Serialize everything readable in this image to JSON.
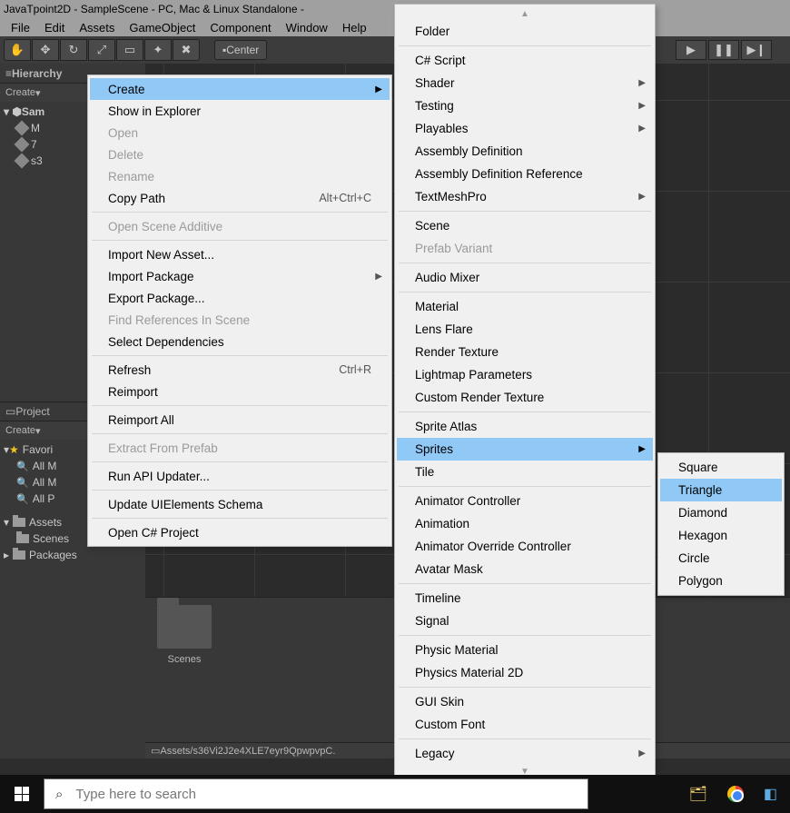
{
  "titlebar": "JavaTpoint2D - SampleScene - PC, Mac & Linux Standalone -",
  "menubar": [
    "File",
    "Edit",
    "Assets",
    "GameObject",
    "Component",
    "Window",
    "Help"
  ],
  "toolbar": {
    "center_button": "Center",
    "tool_icons": [
      "hand",
      "move",
      "rotate",
      "scale",
      "rect",
      "transform",
      "custom"
    ]
  },
  "hierarchy": {
    "title": "Hierarchy",
    "create_label": "Create",
    "scene_name": "Sam",
    "items": [
      "M",
      "7",
      "s3"
    ]
  },
  "project": {
    "title": "Project",
    "create_label": "Create",
    "favorites_label": "Favori",
    "fav_items": [
      "All M",
      "All M",
      "All P"
    ],
    "assets_label": "Assets",
    "assets_children": [
      "Scenes"
    ],
    "packages_label": "Packages"
  },
  "asset_grid": {
    "item_label": "Scenes"
  },
  "path_bar": "Assets/s36Vi2J2e4XLE7eyr9QpwpvpC.",
  "context_menu_1": {
    "items": [
      {
        "label": "Create",
        "submenu": true,
        "highlight": true
      },
      {
        "label": "Show in Explorer"
      },
      {
        "label": "Open",
        "disabled": true
      },
      {
        "label": "Delete",
        "disabled": true
      },
      {
        "label": "Rename",
        "disabled": true
      },
      {
        "label": "Copy Path",
        "shortcut": "Alt+Ctrl+C"
      },
      {
        "sep": true
      },
      {
        "label": "Open Scene Additive",
        "disabled": true
      },
      {
        "sep": true
      },
      {
        "label": "Import New Asset..."
      },
      {
        "label": "Import Package",
        "submenu": true
      },
      {
        "label": "Export Package..."
      },
      {
        "label": "Find References In Scene",
        "disabled": true
      },
      {
        "label": "Select Dependencies"
      },
      {
        "sep": true
      },
      {
        "label": "Refresh",
        "shortcut": "Ctrl+R"
      },
      {
        "label": "Reimport"
      },
      {
        "sep": true
      },
      {
        "label": "Reimport All"
      },
      {
        "sep": true
      },
      {
        "label": "Extract From Prefab",
        "disabled": true
      },
      {
        "sep": true
      },
      {
        "label": "Run API Updater..."
      },
      {
        "sep": true
      },
      {
        "label": "Update UIElements Schema"
      },
      {
        "sep": true
      },
      {
        "label": "Open C# Project"
      }
    ]
  },
  "context_menu_2": {
    "items": [
      {
        "label": "Folder"
      },
      {
        "sep": true
      },
      {
        "label": "C# Script"
      },
      {
        "label": "Shader",
        "submenu": true
      },
      {
        "label": "Testing",
        "submenu": true
      },
      {
        "label": "Playables",
        "submenu": true
      },
      {
        "label": "Assembly Definition"
      },
      {
        "label": "Assembly Definition Reference"
      },
      {
        "label": "TextMeshPro",
        "submenu": true
      },
      {
        "sep": true
      },
      {
        "label": "Scene"
      },
      {
        "label": "Prefab Variant",
        "disabled": true
      },
      {
        "sep": true
      },
      {
        "label": "Audio Mixer"
      },
      {
        "sep": true
      },
      {
        "label": "Material"
      },
      {
        "label": "Lens Flare"
      },
      {
        "label": "Render Texture"
      },
      {
        "label": "Lightmap Parameters"
      },
      {
        "label": "Custom Render Texture"
      },
      {
        "sep": true
      },
      {
        "label": "Sprite Atlas"
      },
      {
        "label": "Sprites",
        "submenu": true,
        "highlight": true
      },
      {
        "label": "Tile"
      },
      {
        "sep": true
      },
      {
        "label": "Animator Controller"
      },
      {
        "label": "Animation"
      },
      {
        "label": "Animator Override Controller"
      },
      {
        "label": "Avatar Mask"
      },
      {
        "sep": true
      },
      {
        "label": "Timeline"
      },
      {
        "label": "Signal"
      },
      {
        "sep": true
      },
      {
        "label": "Physic Material"
      },
      {
        "label": "Physics Material 2D"
      },
      {
        "sep": true
      },
      {
        "label": "GUI Skin"
      },
      {
        "label": "Custom Font"
      },
      {
        "sep": true
      },
      {
        "label": "Legacy",
        "submenu": true
      }
    ]
  },
  "context_menu_3": {
    "items": [
      {
        "label": "Square"
      },
      {
        "label": "Triangle",
        "highlight": true
      },
      {
        "label": "Diamond"
      },
      {
        "label": "Hexagon"
      },
      {
        "label": "Circle"
      },
      {
        "label": "Polygon"
      }
    ]
  },
  "taskbar": {
    "search_placeholder": "Type here to search"
  }
}
